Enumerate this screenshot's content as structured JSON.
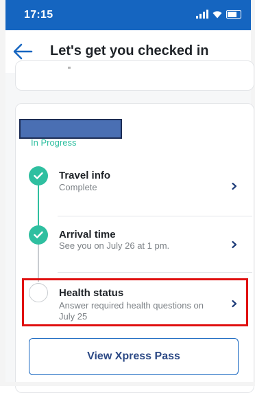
{
  "status_bar": {
    "time": "17:15",
    "background": "#1565c0"
  },
  "header": {
    "title": "Let's get you checked in",
    "back_icon": "arrow-left-icon"
  },
  "checkin": {
    "status_label": "In Progress",
    "steps": [
      {
        "title": "Travel info",
        "subtitle": "Complete",
        "state": "complete"
      },
      {
        "title": "Arrival time",
        "subtitle": "See you on July 26 at 1 pm.",
        "state": "complete"
      },
      {
        "title": "Health status",
        "subtitle_line1": "Answer required health questions on",
        "subtitle_line2": "July 25",
        "state": "pending"
      }
    ]
  },
  "actions": {
    "xpress_pass_label": "View Xpress Pass"
  },
  "colors": {
    "accent_teal": "#2fbfa0",
    "brand_blue": "#1565c0",
    "highlight_red": "#e01010",
    "redaction": "#4a6fb3"
  }
}
